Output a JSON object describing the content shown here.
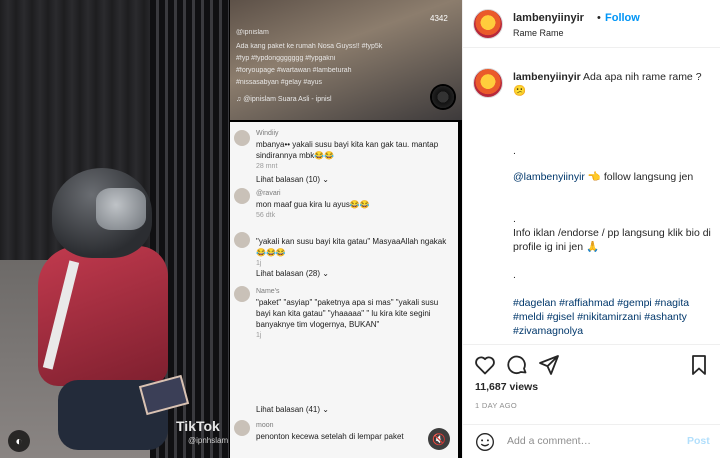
{
  "header": {
    "username": "lambenyiinyir",
    "follow_label": "Follow",
    "subtitle": "Rame Rame"
  },
  "caption": {
    "username": "lambenyiinyir",
    "text": "Ada apa nih rame rame ? 😕",
    "dot1": ".",
    "mention": "@lambenyiinyir",
    "mention_suffix": "👈 follow langsung jen",
    "dot2": ".",
    "info": "Info iklan /endorse / pp langsung klik bio di profile ig ini jen 🙏",
    "dot3": ".",
    "hashtags": "#dagelan #raffiahmad #gempi #nagita #meldi #gisel #nikitamirzani #ashanty #zivamagnolya"
  },
  "stats": {
    "views": "11,687 views",
    "time_ago": "1 DAY AGO"
  },
  "comment_input": {
    "placeholder": "Add a comment…",
    "post_label": "Post"
  },
  "video_overlay": {
    "count": "4342",
    "user": "@ipnislam",
    "caption_line1": "Ada kang paket ke rumah Nosa Guyss!! #fyp5k",
    "caption_line2": "#fyp #fypdonggggggg #fypgakni",
    "caption_line3": "#foryoupage #wartawan #lambeturah",
    "caption_line4": "#nissasabyan #gelay #ayus",
    "sound": "♫ @ipnislam Suara Asli - ipnisl",
    "tiktok": "TikTok",
    "tiktok_handle": "@ipnhslam"
  },
  "video_comments": [
    {
      "user": "Windiiy",
      "text": "mbanya•• yakali susu bayi kita kan gak tau. mantap sindirannya mbk😂😂",
      "meta": "28 mnt"
    },
    {
      "user": "Lihat balasan (10) ⌄",
      "text": "",
      "meta": ""
    },
    {
      "user": "@ravari",
      "text": "mon maaf gua kira lu ayus😂😂",
      "meta": "56 dtk"
    },
    {
      "user": "",
      "text": "\"yakali kan susu bayi kita gatau\" MasyaaAllah ngakak😂😂😂",
      "meta": "1j"
    },
    {
      "user": "Lihat balasan (28) ⌄",
      "text": "",
      "meta": ""
    },
    {
      "user": "Name's ",
      "text": "\"paket\" \"asyiap\" \"paketnya apa si mas\" \"yakali susu bayi kan kita gatau\" \"yhaaaaa\" \" lu kira kite segini banyaknye tim vlogernya, BUKAN\"",
      "meta": "1j"
    },
    {
      "user": "Lihat balasan (41) ⌄",
      "text": "",
      "meta": ""
    },
    {
      "user": "moon",
      "text": "penonton kecewa setelah di lempar paket",
      "meta": ""
    }
  ]
}
